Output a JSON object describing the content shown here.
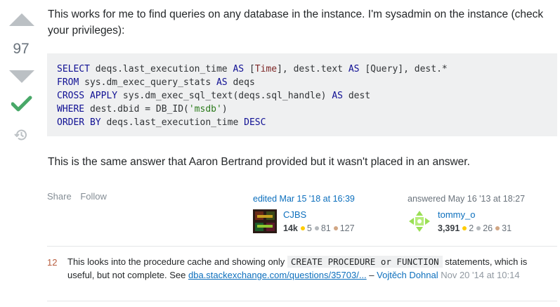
{
  "vote": {
    "count": "97"
  },
  "post": {
    "intro": "This works for me to find queries on any database in the instance. I'm sysadmin on the instance (check your privileges):",
    "code": {
      "l1": {
        "kw1": "SELECT",
        "t1": " deqs.last_execution_time ",
        "kw2": "AS",
        "t2": " [",
        "ty": "Time",
        "t3": "], dest.text ",
        "kw3": "AS",
        "t4": " [Query], dest.*"
      },
      "l2": {
        "kw1": "FROM",
        "t1": " sys.dm_exec_query_stats ",
        "kw2": "AS",
        "t2": " deqs"
      },
      "l3": {
        "kw1": "CROSS APPLY",
        "t1": " sys.dm_exec_sql_text(deqs.sql_handle) ",
        "kw2": "AS",
        "t2": " dest"
      },
      "l4": {
        "kw1": "WHERE",
        "t1": " dest.dbid = DB_ID(",
        "str": "'msdb'",
        "t2": ")"
      },
      "l5": {
        "kw1": "ORDER BY",
        "t1": " deqs.last_execution_time ",
        "kw2": "DESC"
      }
    },
    "body": "This is the same answer that Aaron Bertrand provided but it wasn't placed in an answer."
  },
  "menu": {
    "share": "Share",
    "follow": "Follow"
  },
  "editor": {
    "action": "edited Mar 15 '18 at 16:39",
    "name": "CJBS",
    "rep": "14k",
    "gold": "5",
    "silver": "81",
    "bronze": "127"
  },
  "author": {
    "action": "answered May 16 '13 at 18:27",
    "name": "tommy_o",
    "rep": "3,391",
    "gold": "2",
    "silver": "26",
    "bronze": "31"
  },
  "comment": {
    "score": "12",
    "text1": "This looks into the procedure cache and showing only ",
    "code": "CREATE PROCEDURE or FUNCTION",
    "text2": " statements, which is useful, but not complete. See ",
    "link": "dba.stackexchange.com/questions/35703/...",
    "sep": " – ",
    "user": "Vojtěch Dohnal",
    "date": "Nov 20 '14 at 10:14"
  }
}
